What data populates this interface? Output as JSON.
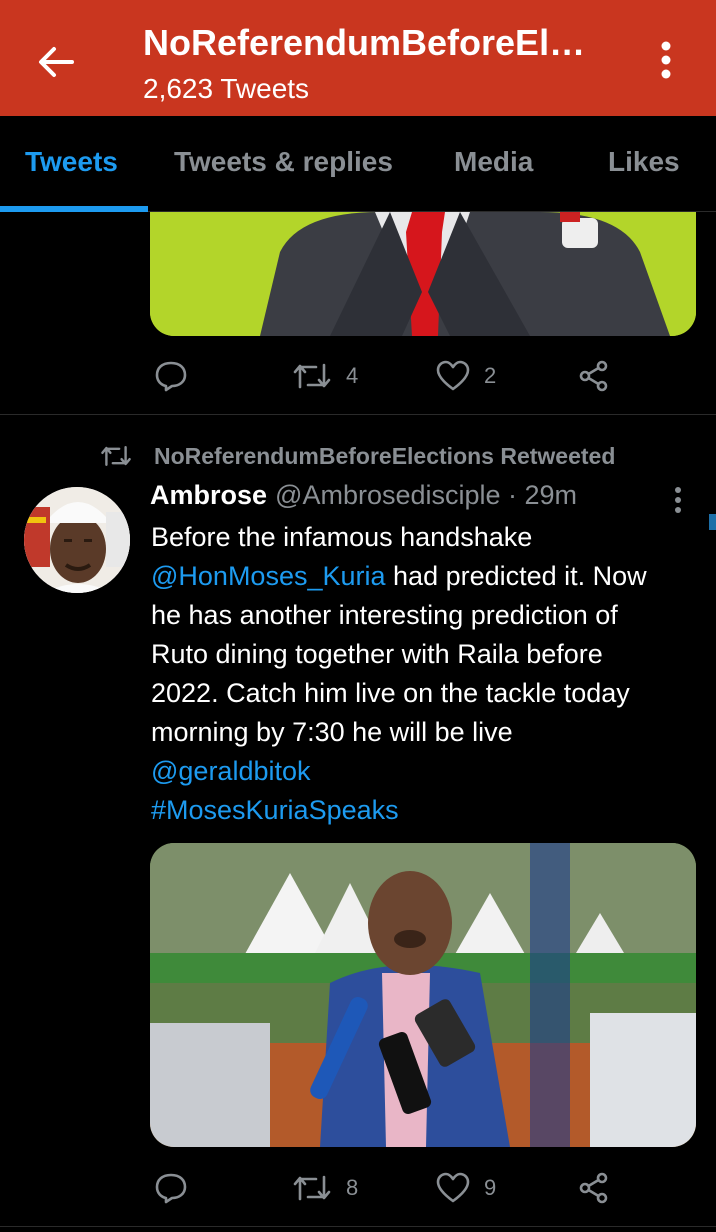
{
  "header": {
    "title": "NoReferendumBeforeEl…",
    "subtitle": "2,623 Tweets",
    "back_icon": "arrow-left-icon",
    "more_icon": "vertical-dots-icon"
  },
  "tabs": [
    {
      "label": "Tweets",
      "active": true
    },
    {
      "label": "Tweets & replies",
      "active": false
    },
    {
      "label": "Media",
      "active": false
    },
    {
      "label": "Likes",
      "active": false
    }
  ],
  "colors": {
    "header_bg": "#c9361f",
    "accent": "#1d9bf0",
    "muted": "#8a8f94",
    "background": "#000000"
  },
  "tweets": [
    {
      "retweets": "4",
      "likes": "2"
    },
    {
      "retweeted_by": "NoReferendumBeforeElections Retweeted",
      "name": "Ambrose",
      "handle": "@Ambrosedisciple · 29m",
      "text_lines": [
        "Before the infamous handshake",
        "had predicted it. Now",
        "he has another interesting prediction of",
        "Ruto dining together with Raila before",
        "2022. Catch him live on the tackle today",
        "morning by 7:30 he will be live"
      ],
      "mention_1": "@HonMoses_Kuria",
      "mention_2": "@geraldbitok",
      "hashtag": "#MosesKuriaSpeaks",
      "retweets": "8",
      "likes": "9"
    }
  ]
}
